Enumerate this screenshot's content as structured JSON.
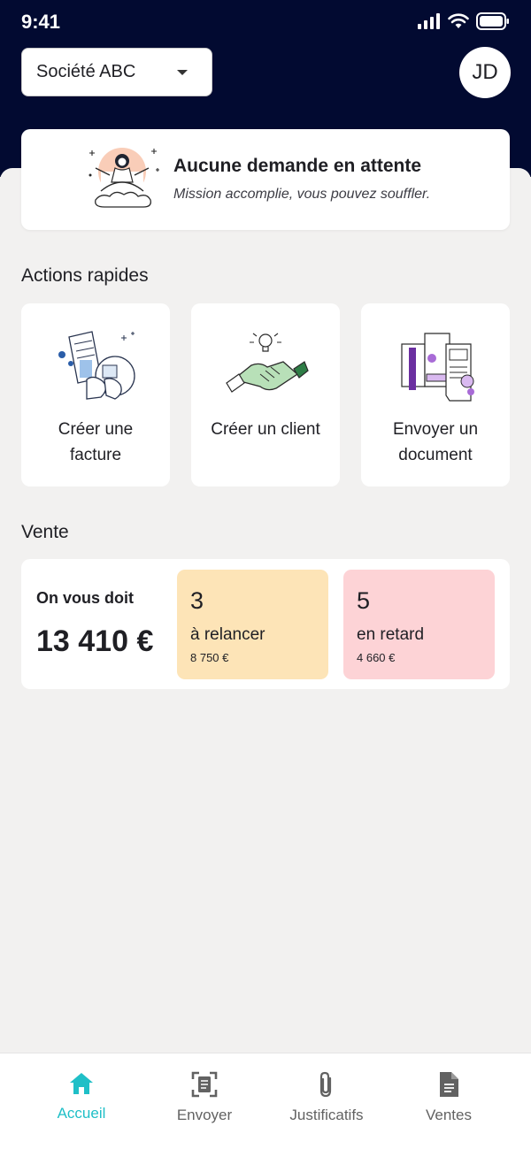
{
  "status_bar": {
    "time": "9:41"
  },
  "header": {
    "company": "Société ABC",
    "avatar_initials": "JD"
  },
  "pending": {
    "title": "Aucune demande en attente",
    "subtitle": "Mission accomplie, vous pouvez souffler."
  },
  "quick_actions": {
    "title": "Actions rapides",
    "items": [
      {
        "label": "Créer une facture",
        "icon": "invoice-illustration"
      },
      {
        "label": "Créer un client",
        "icon": "handshake-illustration"
      },
      {
        "label": "Envoyer un document",
        "icon": "documents-illustration"
      }
    ]
  },
  "sales": {
    "title": "Vente",
    "owed_label": "On vous doit",
    "owed_amount": "13 410 €",
    "tiles": [
      {
        "count": "3",
        "label": "à relancer",
        "amount": "8 750 €",
        "color": "#fde4b7"
      },
      {
        "count": "5",
        "label": "en retard",
        "amount": "4 660 €",
        "color": "#fdd3d6"
      }
    ]
  },
  "nav": {
    "active_color": "#1fbfc7",
    "items": [
      {
        "label": "Accueil",
        "icon": "home-icon"
      },
      {
        "label": "Envoyer",
        "icon": "scan-document-icon"
      },
      {
        "label": "Justificatifs",
        "icon": "paperclip-icon"
      },
      {
        "label": "Ventes",
        "icon": "document-icon"
      }
    ]
  }
}
